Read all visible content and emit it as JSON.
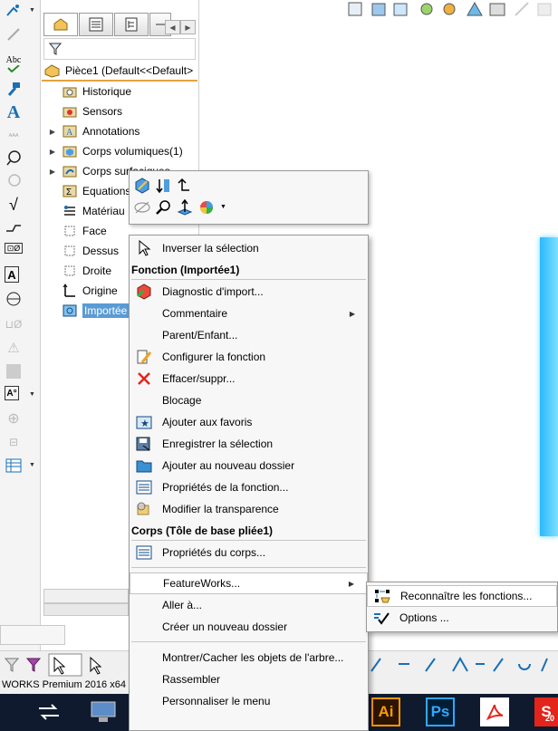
{
  "left_toolbar": {
    "icons": [
      "sketch-icon",
      "smart-dimension-icon",
      "spell-check-icon",
      "format-painter-icon",
      "text-icon",
      "abc-disabled-icon",
      "balloon-icon",
      "auto-balloon-icon",
      "surface-finish-icon",
      "weld-symbol-icon",
      "hole-callout-icon",
      "geometric-tolerance-icon",
      "datum-feature-icon",
      "datum-target-icon",
      "blocks-icon",
      "center-mark-icon",
      "centerline-icon",
      "area-hatch-icon",
      "revision-icon",
      "table-icon"
    ],
    "abc_label": "Abc"
  },
  "tabs": [
    "feature-manager-tab",
    "property-manager-tab",
    "configuration-manager-tab",
    "dim-xpert-tab"
  ],
  "tree": {
    "root": "Pièce1  (Default<<Default>",
    "items": [
      {
        "label": "Historique",
        "icon": "history-folder-icon",
        "expandable": false
      },
      {
        "label": "Sensors",
        "icon": "sensors-icon",
        "expandable": false
      },
      {
        "label": "Annotations",
        "icon": "annotations-icon",
        "expandable": true
      },
      {
        "label": "Corps volumiques(1)",
        "icon": "solid-bodies-icon",
        "expandable": true
      },
      {
        "label": "Corps surfaciques",
        "icon": "surface-bodies-icon",
        "expandable": true
      },
      {
        "label": "Equations",
        "icon": "equations-icon",
        "expandable": false
      },
      {
        "label": "Matériau",
        "icon": "material-icon",
        "expandable": false
      },
      {
        "label": "Face",
        "icon": "plane-icon",
        "expandable": false
      },
      {
        "label": "Dessus",
        "icon": "plane-icon",
        "expandable": false
      },
      {
        "label": "Droite",
        "icon": "plane-icon",
        "expandable": false
      },
      {
        "label": "Origine",
        "icon": "origin-icon",
        "expandable": false
      },
      {
        "label": "Importée",
        "icon": "imported-feature-icon",
        "expandable": false,
        "selected": true
      }
    ]
  },
  "context_toolbar": {
    "row1": [
      "edit-feature-icon",
      "rollback-icon",
      "undo-arrow-icon"
    ],
    "row2": [
      "hide-icon",
      "zoom-selection-icon",
      "normal-to-icon",
      "appearance-icon"
    ]
  },
  "context_menu": {
    "items": [
      {
        "type": "item",
        "label": "Inverser la sélection",
        "icon": "cursor-icon"
      },
      {
        "type": "header",
        "label": "Fonction (Importée1)"
      },
      {
        "type": "item",
        "label": "Diagnostic d'import...",
        "icon": "import-diagnostic-icon"
      },
      {
        "type": "item",
        "label": "Commentaire",
        "submenu": true
      },
      {
        "type": "item",
        "label": "Parent/Enfant..."
      },
      {
        "type": "item",
        "label": "Configurer la fonction",
        "icon": "configure-pencil-icon"
      },
      {
        "type": "item",
        "label": "Effacer/suppr...",
        "icon": "delete-x-icon"
      },
      {
        "type": "item",
        "label": "Blocage"
      },
      {
        "type": "item",
        "label": "Ajouter aux favoris",
        "icon": "favorites-star-icon"
      },
      {
        "type": "item",
        "label": "Enregistrer la sélection",
        "icon": "save-selection-icon"
      },
      {
        "type": "item",
        "label": "Ajouter au nouveau dossier",
        "icon": "folder-icon"
      },
      {
        "type": "item",
        "label": "Propriétés de la fonction...",
        "icon": "properties-icon"
      },
      {
        "type": "item",
        "label": "Modifier la transparence",
        "icon": "transparency-icon"
      },
      {
        "type": "header",
        "label": "Corps (Tôle de base pliée1)"
      },
      {
        "type": "item",
        "label": "Propriétés du corps...",
        "icon": "properties-icon"
      },
      {
        "type": "separator"
      },
      {
        "type": "item",
        "label": "FeatureWorks...",
        "submenu": true,
        "highlight": true
      },
      {
        "type": "item",
        "label": "Aller à..."
      },
      {
        "type": "item",
        "label": "Créer un nouveau dossier"
      },
      {
        "type": "separator"
      },
      {
        "type": "item",
        "label": "Montrer/Cacher les objets de l'arbre..."
      },
      {
        "type": "item",
        "label": "Rassembler"
      },
      {
        "type": "item",
        "label": "Personnaliser le menu"
      }
    ]
  },
  "submenu": {
    "items": [
      {
        "label": "Reconnaître les fonctions...",
        "icon": "recognize-features-icon",
        "highlight": true
      },
      {
        "label": "Options ...",
        "icon": "options-check-icon"
      }
    ]
  },
  "status_bar": {
    "text": "WORKS Premium 2016 x64"
  },
  "taskbar": {
    "apps": [
      {
        "label": "",
        "name": "switch-windows-icon"
      },
      {
        "label": "",
        "name": "monitor-icon"
      },
      {
        "label": "Ai",
        "name": "illustrator-icon",
        "color": "#ff9a00"
      },
      {
        "label": "Ps",
        "name": "photoshop-icon",
        "color": "#31a8ff"
      },
      {
        "label": "",
        "name": "acrobat-icon",
        "color": "#e3241b"
      },
      {
        "label": "S",
        "name": "solidworks-taskbar-icon",
        "color": "#e3241b"
      }
    ],
    "sw_year": "20"
  },
  "colors": {
    "selection": "#5b9bd5",
    "tree_separator": "#e6a23c",
    "taskbar": "#0f1a2e",
    "part_blue": "#2ab8ff"
  }
}
